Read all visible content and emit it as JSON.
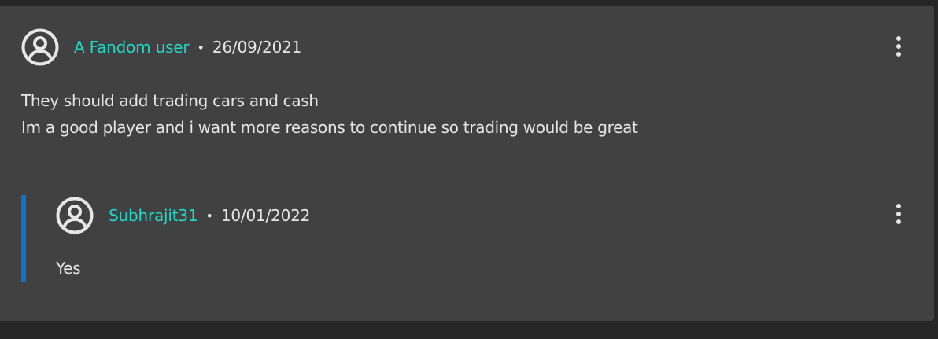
{
  "comment": {
    "author": "A Fandom user",
    "separator": "•",
    "date": "26/09/2021",
    "lines": [
      "They should add trading cars and cash",
      "Im a good player and i want more reasons to continue so trading would be great"
    ],
    "avatar_icon": "user-circle-icon",
    "menu_icon": "more-vertical-icon"
  },
  "reply": {
    "author": "Subhrajit31",
    "separator": "•",
    "date": "10/01/2022",
    "lines": [
      "Yes"
    ],
    "avatar_icon": "user-circle-icon",
    "menu_icon": "more-vertical-icon"
  },
  "colors": {
    "page_background": "#262626",
    "card_background": "#414141",
    "username": "#1fd8c6",
    "text": "#e6e6e6",
    "reply_accent": "#0f74c8"
  }
}
